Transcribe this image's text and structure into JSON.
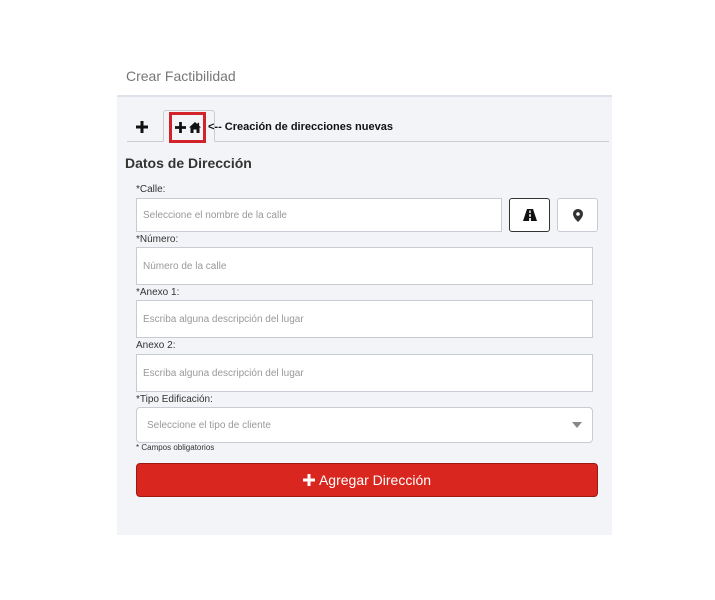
{
  "page_title": "Crear Factibilidad",
  "tabs": {
    "add_icon": "plus-icon",
    "active_icons": [
      "plus-icon",
      "home-icon"
    ],
    "annotation": "<-- Creación de direcciones nuevas",
    "highlight_color": "#d2232a"
  },
  "section_title": "Datos de Dirección",
  "fields": {
    "calle": {
      "label": "*Calle:",
      "placeholder": "Seleccione el nombre de la calle"
    },
    "numero": {
      "label": "*Número:",
      "placeholder": "Número de la calle"
    },
    "anexo1": {
      "label": "*Anexo 1:",
      "placeholder": "Escriba alguna descripción del lugar"
    },
    "anexo2": {
      "label": "Anexo 2:",
      "placeholder": "Escriba alguna descripción del lugar"
    },
    "tipo": {
      "label": "*Tipo Edificación:",
      "placeholder": "Seleccione el tipo de cliente"
    }
  },
  "buttons": {
    "road_icon": "road-icon",
    "pin_icon": "map-pin-icon",
    "add_label": "Agregar Dirección",
    "add_color": "#d9271f"
  },
  "required_note": "* Campos obligatorios"
}
